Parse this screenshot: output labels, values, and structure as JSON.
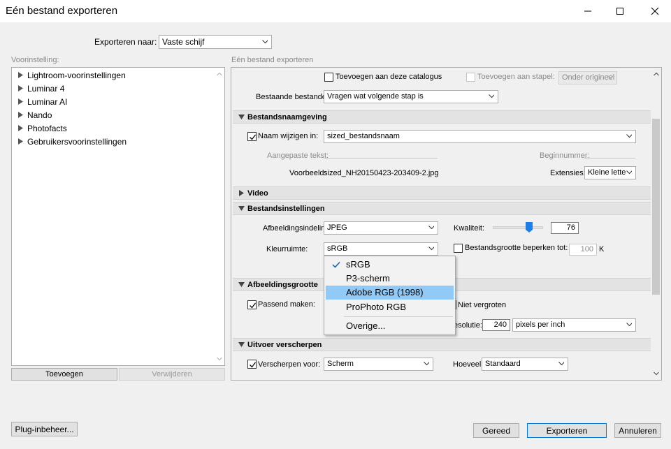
{
  "window": {
    "title": "Eén bestand exporteren",
    "minimize_icon": "minimize-icon",
    "maximize_icon": "maximize-icon",
    "close_icon": "close-icon"
  },
  "export_to": {
    "label": "Exporteren naar:",
    "value": "Vaste schijf"
  },
  "presets": {
    "header": "Voorinstelling:",
    "items": [
      "Lightroom-voorinstellingen",
      "Luminar 4",
      "Luminar AI",
      "Nando",
      "Photofacts",
      "Gebruikersvoorinstellingen"
    ],
    "add_button": "Toevoegen",
    "remove_button": "Verwijderen"
  },
  "settings": {
    "header": "Eén bestand exporteren",
    "add_to_catalog": "Toevoegen aan deze catalogus",
    "add_to_stack": "Toevoegen aan stapel:",
    "stack_position": "Onder origineel",
    "existing_files_label": "Bestaande bestanden:",
    "existing_files_value": "Vragen wat volgende stap is",
    "file_naming": {
      "title": "Bestandsnaamgeving",
      "rename_label": "Naam wijzigen in:",
      "rename_value": "sized_bestandsnaam",
      "custom_text_label": "Aangepaste tekst:",
      "start_number_label": "Beginnummer:",
      "example_label": "Voorbeeld:",
      "example_value": "sized_NH20150423-203409-2.jpg",
      "extensions_label": "Extensies:",
      "extensions_value": "Kleine letters"
    },
    "video": {
      "title": "Video"
    },
    "file_settings": {
      "title": "Bestandsinstellingen",
      "format_label": "Afbeeldingsindeling:",
      "format_value": "JPEG",
      "quality_label": "Kwaliteit:",
      "quality_value": "76",
      "color_space_label": "Kleurruimte:",
      "color_space_value": "sRGB",
      "limit_size_label": "Bestandsgrootte beperken tot:",
      "limit_size_value": "100",
      "limit_size_unit": "K"
    },
    "color_space_menu": {
      "items": [
        "sRGB",
        "P3-scherm",
        "Adobe RGB (1998)",
        "ProPhoto RGB",
        "Overige..."
      ]
    },
    "image_sizing": {
      "title": "Afbeeldingsgrootte",
      "resize_label": "Passend maken:",
      "dont_enlarge": "Niet vergroten",
      "resolution_label": "esolutie:",
      "resolution_value": "240",
      "resolution_unit": "pixels per inch"
    },
    "output_sharpening": {
      "title": "Uitvoer verscherpen",
      "sharpen_label": "Verscherpen voor:",
      "sharpen_value": "Scherm",
      "amount_label": "Hoeveel:",
      "amount_value": "Standaard"
    }
  },
  "footer": {
    "plugin_button": "Plug-inbeheer...",
    "done_button": "Gereed",
    "export_button": "Exporteren",
    "cancel_button": "Annuleren"
  }
}
